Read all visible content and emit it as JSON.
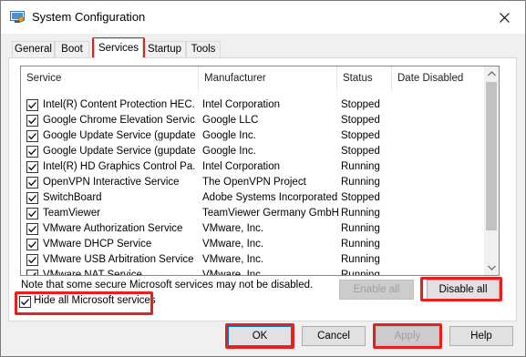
{
  "window": {
    "title": "System Configuration"
  },
  "tabs": [
    {
      "label": "General"
    },
    {
      "label": "Boot"
    },
    {
      "label": "Services"
    },
    {
      "label": "Startup"
    },
    {
      "label": "Tools"
    }
  ],
  "columns": {
    "service": "Service",
    "manufacturer": "Manufacturer",
    "status": "Status",
    "date_disabled": "Date Disabled"
  },
  "services": [
    {
      "name": "Intel(R) Content Protection HEC...",
      "manufacturer": "Intel Corporation",
      "status": "Stopped",
      "checked": true
    },
    {
      "name": "Google Chrome Elevation Servic...",
      "manufacturer": "Google LLC",
      "status": "Stopped",
      "checked": true
    },
    {
      "name": "Google Update Service (gupdate)",
      "manufacturer": "Google Inc.",
      "status": "Stopped",
      "checked": true
    },
    {
      "name": "Google Update Service (gupdatem)",
      "manufacturer": "Google Inc.",
      "status": "Stopped",
      "checked": true
    },
    {
      "name": "Intel(R) HD Graphics Control Pa...",
      "manufacturer": "Intel Corporation",
      "status": "Running",
      "checked": true
    },
    {
      "name": "OpenVPN Interactive Service",
      "manufacturer": "The OpenVPN Project",
      "status": "Running",
      "checked": true
    },
    {
      "name": "SwitchBoard",
      "manufacturer": "Adobe Systems Incorporated",
      "status": "Stopped",
      "checked": true
    },
    {
      "name": "TeamViewer",
      "manufacturer": "TeamViewer Germany GmbH",
      "status": "Running",
      "checked": true
    },
    {
      "name": "VMware Authorization Service",
      "manufacturer": "VMware, Inc.",
      "status": "Running",
      "checked": true
    },
    {
      "name": "VMware DHCP Service",
      "manufacturer": "VMware, Inc.",
      "status": "Running",
      "checked": true
    },
    {
      "name": "VMware USB Arbitration Service",
      "manufacturer": "VMware, Inc.",
      "status": "Running",
      "checked": true
    },
    {
      "name": "VMware NAT Service",
      "manufacturer": "VMware, Inc.",
      "status": "Running",
      "checked": true
    }
  ],
  "note": "Note that some secure Microsoft services may not be disabled.",
  "buttons": {
    "enable_all": "Enable all",
    "disable_all": "Disable all",
    "ok": "OK",
    "cancel": "Cancel",
    "apply": "Apply",
    "help": "Help"
  },
  "hide_ms": {
    "label": "Hide all Microsoft services",
    "checked": true
  },
  "icons": {
    "close": "close-icon",
    "app": "system-configuration-icon"
  },
  "colors": {
    "highlight": "#e8201d",
    "accent": "#0078d7"
  }
}
